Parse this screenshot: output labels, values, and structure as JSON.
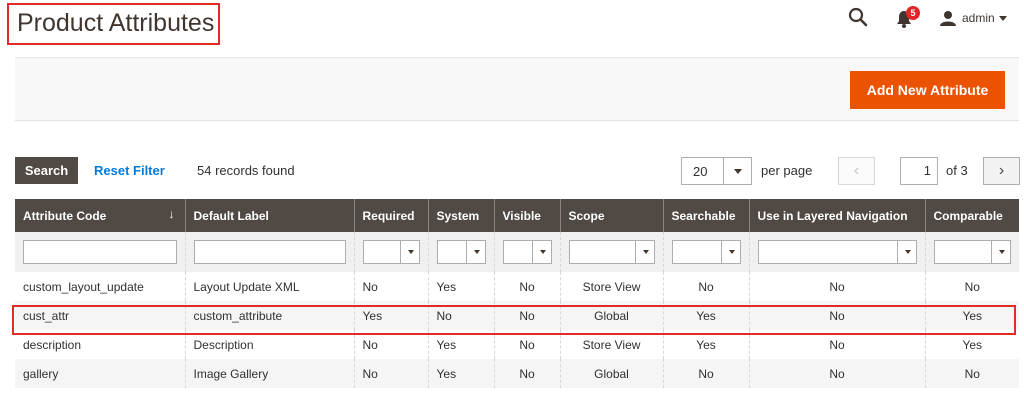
{
  "page": {
    "title": "Product Attributes"
  },
  "header": {
    "notifications_count": "5",
    "username": "admin"
  },
  "actions": {
    "add_label": "Add New Attribute"
  },
  "toolbar": {
    "search_label": "Search",
    "reset_label": "Reset Filter",
    "records_text": "54 records found",
    "per_page_value": "20",
    "per_page_label": "per page",
    "current_page": "1",
    "of_pages": "of 3"
  },
  "grid": {
    "columns": [
      "Attribute Code",
      "Default Label",
      "Required",
      "System",
      "Visible",
      "Scope",
      "Searchable",
      "Use in Layered Navigation",
      "Comparable"
    ],
    "sorted_column": "Attribute Code",
    "rows": [
      [
        "custom_layout_update",
        "Layout Update XML",
        "No",
        "Yes",
        "No",
        "Store View",
        "No",
        "No",
        "No"
      ],
      [
        "cust_attr",
        "custom_attribute",
        "Yes",
        "No",
        "No",
        "Global",
        "Yes",
        "No",
        "Yes"
      ],
      [
        "description",
        "Description",
        "No",
        "Yes",
        "No",
        "Store View",
        "Yes",
        "No",
        "Yes"
      ],
      [
        "gallery",
        "Image Gallery",
        "No",
        "Yes",
        "No",
        "Global",
        "No",
        "No",
        "No"
      ]
    ],
    "highlighted_row": 1
  },
  "colors": {
    "accent": "#eb5202",
    "header_bg": "#514943",
    "highlight": "#e02b27",
    "link": "#007bdb"
  }
}
